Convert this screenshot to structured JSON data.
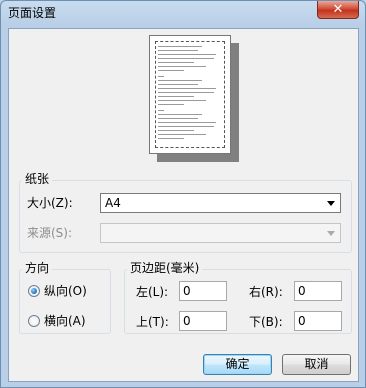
{
  "window": {
    "title": "页面设置",
    "close_glyph": "✕"
  },
  "paper": {
    "group_label": "纸张",
    "size_label": "大小(Z):",
    "size_value": "A4",
    "source_label": "来源(S):",
    "source_value": ""
  },
  "orientation": {
    "group_label": "方向",
    "portrait_label": "纵向(O)",
    "landscape_label": "横向(A)",
    "selected": "portrait"
  },
  "margins": {
    "group_label": "页边距(毫米)",
    "left_label": "左(L):",
    "left_value": "0",
    "right_label": "右(R):",
    "right_value": "0",
    "top_label": "上(T):",
    "top_value": "0",
    "bottom_label": "下(B):",
    "bottom_value": "0"
  },
  "buttons": {
    "ok": "确定",
    "cancel": "取消"
  }
}
